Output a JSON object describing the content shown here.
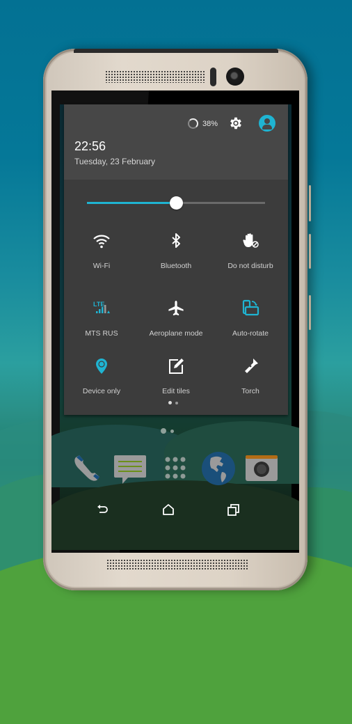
{
  "status_header": {
    "battery_percent": "38%",
    "battery_level": 0.38,
    "time": "22:56",
    "date": "Tuesday, 23 February",
    "settings_icon": "gear-icon",
    "user_icon": "account-circle-icon"
  },
  "brightness": {
    "level": 0.5
  },
  "quick_settings": {
    "tiles": [
      {
        "label": "Wi-Fi",
        "icon": "wifi-icon",
        "active": true
      },
      {
        "label": "Bluetooth",
        "icon": "bluetooth-icon",
        "active": false
      },
      {
        "label": "Do not disturb",
        "icon": "do-not-disturb-hand-icon",
        "active": false
      },
      {
        "label": "MTS RUS",
        "icon": "lte-signal-icon",
        "active": true
      },
      {
        "label": "Aeroplane mode",
        "icon": "airplane-icon",
        "active": false
      },
      {
        "label": "Auto-rotate",
        "icon": "auto-rotate-icon",
        "active": true
      },
      {
        "label": "Device only",
        "icon": "location-pin-icon",
        "active": true
      },
      {
        "label": "Edit tiles",
        "icon": "edit-icon",
        "active": false
      },
      {
        "label": "Torch",
        "icon": "flashlight-icon",
        "active": false
      }
    ],
    "page": 1,
    "page_count": 2
  },
  "home_screen": {
    "page": 1,
    "page_count": 2,
    "dock": [
      {
        "name": "Phone",
        "icon": "phone-icon"
      },
      {
        "name": "Messages",
        "icon": "message-icon"
      },
      {
        "name": "App drawer",
        "icon": "app-drawer-icon"
      },
      {
        "name": "Browser",
        "icon": "globe-icon"
      },
      {
        "name": "Camera",
        "icon": "camera-icon"
      }
    ]
  },
  "navigation": {
    "back": "back-icon",
    "home": "home-icon",
    "recents": "recents-icon"
  },
  "colors": {
    "accent": "#1fb4d2",
    "shade_background": "#3c3c3c",
    "shade_header": "#474747",
    "phone_body": "#ddd3c6",
    "background_sky": "#037193"
  }
}
